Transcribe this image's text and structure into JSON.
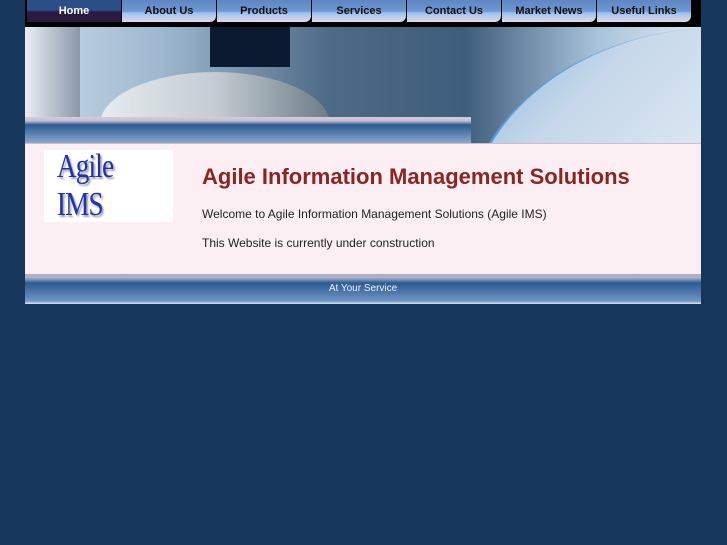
{
  "nav": {
    "items": [
      {
        "label": "Home",
        "active": true
      },
      {
        "label": "About Us"
      },
      {
        "label": "Products"
      },
      {
        "label": "Services"
      },
      {
        "label": "Contact Us"
      },
      {
        "label": "Market News"
      },
      {
        "label": "Useful Links"
      }
    ]
  },
  "logo": {
    "text": "Agile IMS"
  },
  "main": {
    "title": "Agile Information Management Solutions",
    "welcome": "Welcome to Agile Information Management Solutions (Agile IMS)",
    "notice": "This Website is currently under construction"
  },
  "footer": {
    "text": "At Your Service"
  }
}
